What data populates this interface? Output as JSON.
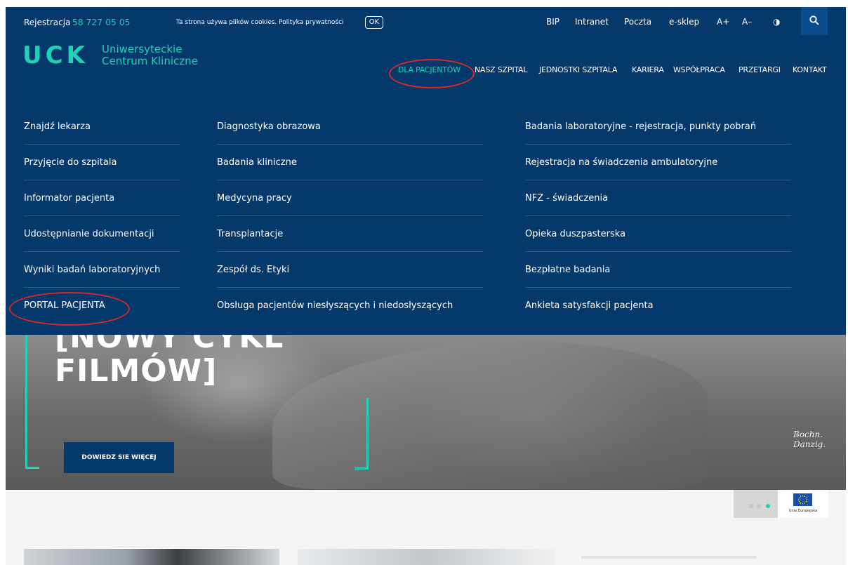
{
  "topbar": {
    "registration_label": "Rejestracja",
    "registration_phone": "58 727 05 05",
    "cookie_text": "Ta strona używa plików cookies. Polityka prywatności",
    "cookie_ok": "OK",
    "links": [
      "BIP",
      "Intranet",
      "Poczta",
      "e-sklep",
      "A+",
      "A–",
      "◑"
    ],
    "search_icon": "search-icon"
  },
  "logo": {
    "abbr": "UCK",
    "line1": "Uniwersyteckie",
    "line2": "Centrum Kliniczne"
  },
  "nav": [
    "DLA PACJENTÓW",
    "NASZ SZPITAL",
    "JEDNOSTKI SZPITALA",
    "KARIERA",
    "WSPÓŁPRACA",
    "PRZETARGI",
    "KONTAKT"
  ],
  "dropdown": {
    "col1": [
      "Znajdź lekarza",
      "Przyjęcie do szpitala",
      "Informator pacjenta",
      "Udostępnianie dokumentacji",
      "Wyniki badań laboratoryjnych",
      "PORTAL PACJENTA"
    ],
    "col2": [
      "Diagnostyka obrazowa",
      "Badania kliniczne",
      "Medycyna pracy",
      "Transplantacje",
      "Zespół ds. Etyki",
      "Obsługa pacjentów niesłyszących i niedosłyszących"
    ],
    "col3": [
      "Badania laboratoryjne - rejestracja, punkty pobrań",
      "Rejestracja na świadczenia ambulatoryjne",
      "NFZ - świadczenia",
      "Opieka duszpasterska",
      "Bezpłatne badania",
      "Ankieta satysfakcji pacjenta"
    ]
  },
  "hero": {
    "title_line1": "[NOWY CYKL",
    "title_line2": "FILMÓW]",
    "button": "DOWIEDZ SIE WIĘCEJ",
    "signature_line1": "Bochn.",
    "signature_line2": "Danzig."
  },
  "eu": {
    "label": "Unia Europejska"
  },
  "colors": {
    "navy": "#05386b",
    "teal": "#1fd1b6",
    "annotation_red": "#d62828"
  }
}
